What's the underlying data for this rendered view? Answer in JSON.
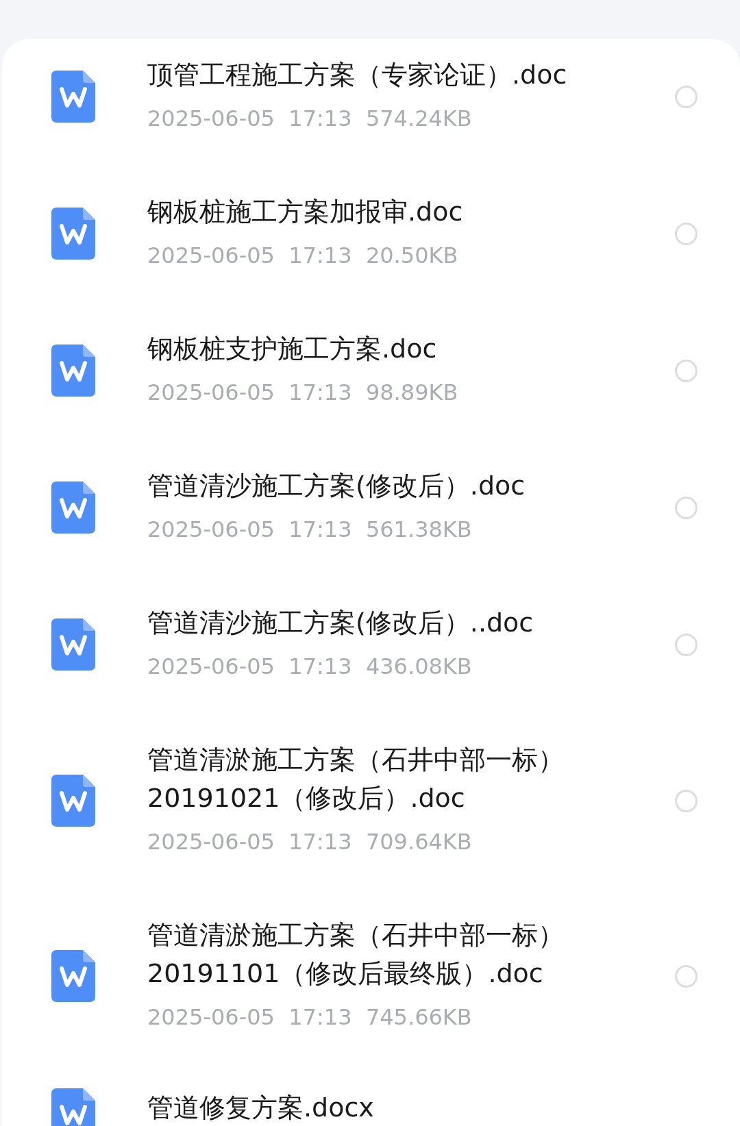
{
  "files": [
    {
      "name": "顶管工程施工方案（专家论证）.doc",
      "meta": "2025-06-05  17:13  574.24KB",
      "selected": false
    },
    {
      "name": "钢板桩施工方案加报审.doc",
      "meta": "2025-06-05  17:13  20.50KB",
      "selected": false
    },
    {
      "name": "钢板桩支护施工方案.doc",
      "meta": "2025-06-05  17:13  98.89KB",
      "selected": false
    },
    {
      "name": "管道清沙施工方案(修改后）.doc",
      "meta": "2025-06-05  17:13  561.38KB",
      "selected": false
    },
    {
      "name": "管道清沙施工方案(修改后）..doc",
      "meta": "2025-06-05  17:13  436.08KB",
      "selected": false
    },
    {
      "name": "管道清淤施工方案（石井中部一标）20191021（修改后）.doc",
      "meta": "2025-06-05  17:13  709.64KB",
      "selected": false
    },
    {
      "name": "管道清淤施工方案（石井中部一标）20191101（修改后最终版）.doc",
      "meta": "2025-06-05  17:13  745.66KB",
      "selected": false
    },
    {
      "name": "管道修复方案.docx"
    }
  ]
}
